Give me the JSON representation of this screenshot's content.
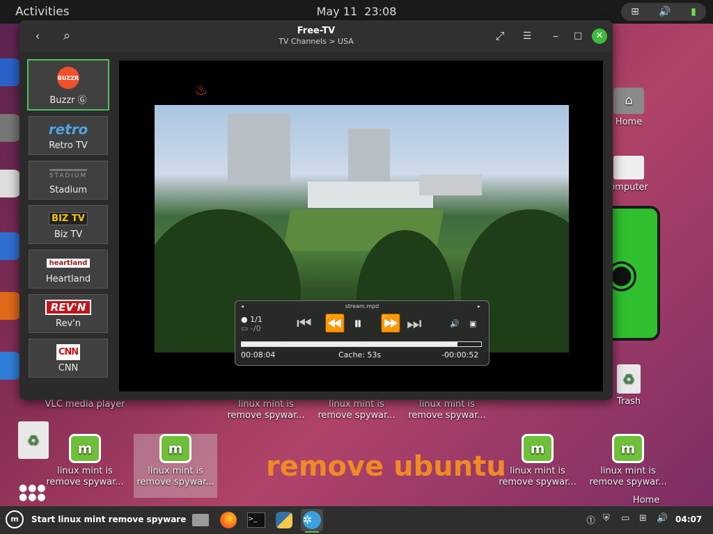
{
  "topbar": {
    "activities": "Activities",
    "date": "May 11",
    "time": "23:08"
  },
  "window": {
    "title": "Free-TV",
    "subtitle": "TV Channels > USA",
    "back_icon": "‹",
    "search_icon": "⌕",
    "fullscreen_icon": "⤢",
    "menu_icon": "☰",
    "minimize_icon": "–",
    "maximize_icon": "□",
    "close_icon": "✕"
  },
  "channels": [
    {
      "name": "Buzzr Ⓖ",
      "logo": "BUZZR",
      "selected": true
    },
    {
      "name": "Retro TV",
      "logo": "retro"
    },
    {
      "name": "Stadium",
      "logo": "STADIUM"
    },
    {
      "name": "Biz TV",
      "logo": "BIZ TV"
    },
    {
      "name": "Heartland",
      "logo": "heartland"
    },
    {
      "name": "Rev'n",
      "logo": "REV'N"
    },
    {
      "name": "CNN",
      "logo": "CNN"
    }
  ],
  "player": {
    "stream": "stream.mpd",
    "playlist_pos": "1/1",
    "chapters": "-/0",
    "elapsed": "00:08:04",
    "cache": "Cache:  53s",
    "remaining": "-00:00:52",
    "progress": 0.9
  },
  "desktop": {
    "vlc_label": "VLC media player",
    "home_label": "Home",
    "computer_label": "omputer",
    "trash_label": "Trash",
    "mint_label": "linux mint is remove spywar...",
    "mint_label_full": "linux mint is remove spyware",
    "big_text": "remove ubuntu",
    "home_partial": "Home"
  },
  "taskbar": {
    "start_label": "Start linux mint remove spyware",
    "clock": "04:07"
  }
}
